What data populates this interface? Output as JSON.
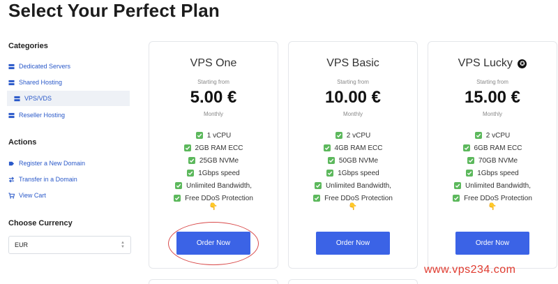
{
  "page": {
    "title": "Select Your Perfect Plan"
  },
  "sidebar": {
    "categories_heading": "Categories",
    "categories": [
      {
        "label": "Dedicated Servers",
        "icon": "server-icon",
        "active": false
      },
      {
        "label": "Shared Hosting",
        "icon": "server-icon",
        "active": false
      },
      {
        "label": "VPS/VDS",
        "icon": "server-icon",
        "active": true
      },
      {
        "label": "Reseller Hosting",
        "icon": "server-icon",
        "active": false
      }
    ],
    "actions_heading": "Actions",
    "actions": [
      {
        "label": "Register a New Domain",
        "icon": "tag-icon"
      },
      {
        "label": "Transfer in a Domain",
        "icon": "transfer-icon"
      },
      {
        "label": "View Cart",
        "icon": "cart-icon"
      }
    ],
    "currency_heading": "Choose Currency",
    "currency_value": "EUR"
  },
  "plans": [
    {
      "name": "VPS One",
      "starting": "Starting from",
      "price": "5.00 €",
      "cycle": "Monthly",
      "features": [
        "1 vCPU",
        "2GB RAM ECC",
        "25GB NVMe",
        "1Gbps speed",
        "Unlimited Bandwidth,",
        "Free DDoS Protection"
      ],
      "emoji": "👇",
      "button": "Order Now",
      "highlighted": true
    },
    {
      "name": "VPS Basic",
      "starting": "Starting from",
      "price": "10.00 €",
      "cycle": "Monthly",
      "features": [
        "2 vCPU",
        "4GB RAM ECC",
        "50GB NVMe",
        "1Gbps speed",
        "Unlimited Bandwidth,",
        "Free DDoS Protection"
      ],
      "emoji": "👇",
      "button": "Order Now",
      "highlighted": false
    },
    {
      "name": "VPS Lucky",
      "name_badge": "✪",
      "starting": "Starting from",
      "price": "15.00 €",
      "cycle": "Monthly",
      "features": [
        "2 vCPU",
        "6GB RAM ECC",
        "70GB NVMe",
        "1Gbps speed",
        "Unlimited Bandwidth,",
        "Free DDoS Protection"
      ],
      "emoji": "👇",
      "button": "Order Now",
      "highlighted": false
    }
  ],
  "colors": {
    "accent": "#3b63e6",
    "link": "#2a59c9",
    "check": "#5cb85c",
    "watermark": "#e03a2e",
    "ring": "#d94a4a"
  },
  "watermark": "www.vps234.com"
}
